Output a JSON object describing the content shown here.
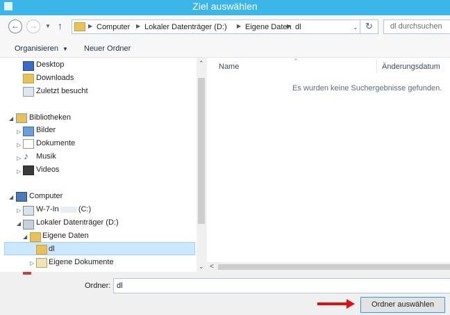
{
  "window": {
    "title": "Ziel auswählen",
    "accent": "#3cb6e8"
  },
  "nav": {
    "breadcrumb": [
      "Computer",
      "Lokaler Datenträger (D:)",
      "Eigene Daten",
      "dl"
    ],
    "search_placeholder": "dl durchsuchen"
  },
  "toolbar": {
    "organize_label": "Organisieren",
    "new_folder_label": "Neuer Ordner"
  },
  "tree": {
    "favorites": [
      "Desktop",
      "Downloads",
      "Zuletzt besucht"
    ],
    "libraries_label": "Bibliotheken",
    "libraries": [
      "Bilder",
      "Dokumente",
      "Musik",
      "Videos"
    ],
    "computer_label": "Computer",
    "drive_c": "W-7-In",
    "drive_c_suffix": "(C:)",
    "drive_d": "Lokaler Datenträger (D:)",
    "eigene_daten": "Eigene Daten",
    "selected": "dl",
    "eigene_dokumente": "Eigene Dokumente"
  },
  "list": {
    "col_name": "Name",
    "col_date": "Änderungsdatum",
    "empty_message": "Es wurden keine Suchergebnisse gefunden."
  },
  "footer": {
    "folder_label": "Ordner:",
    "folder_value": "dl",
    "select_button": "Ordner auswählen"
  }
}
